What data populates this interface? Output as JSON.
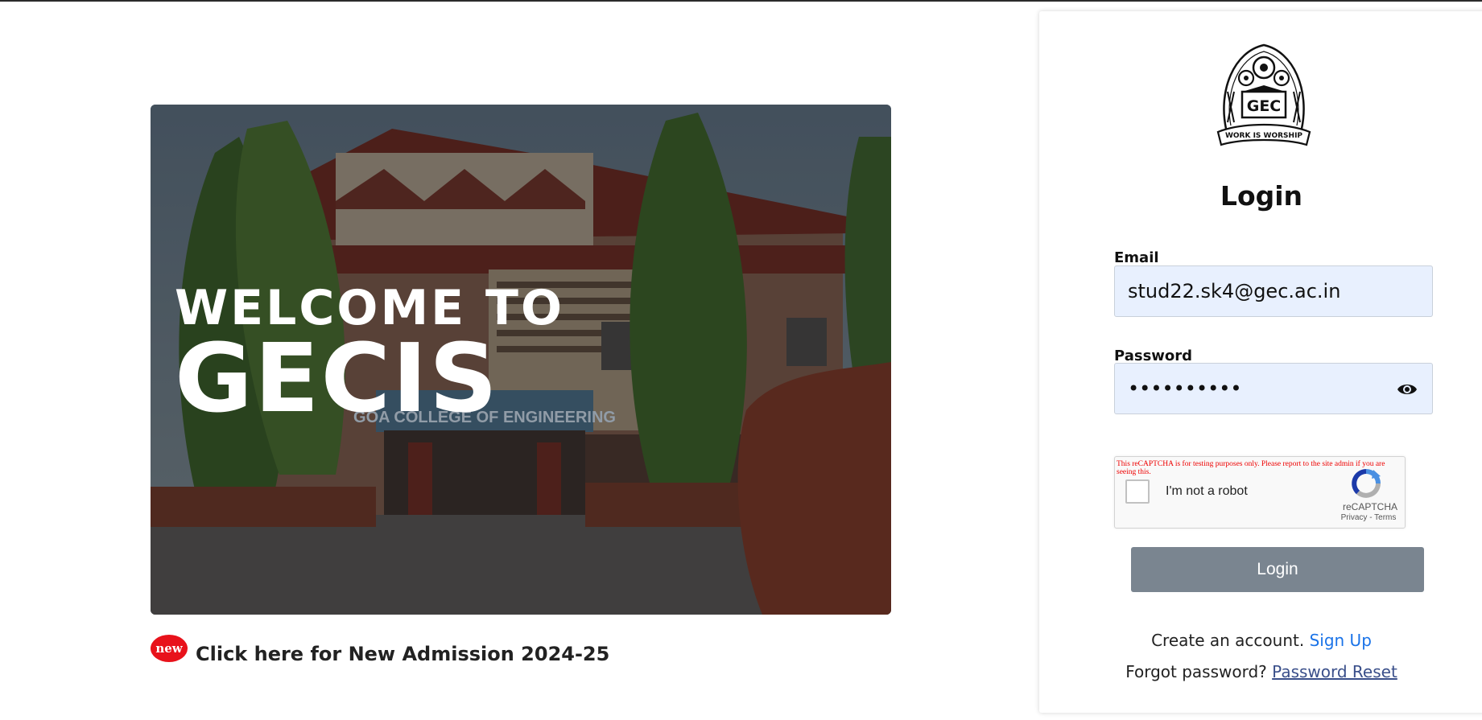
{
  "hero": {
    "welcome_line": "WELCOME TO",
    "brand_line": "GECIS",
    "building_sign": "GOA COLLEGE OF ENGINEERING"
  },
  "admission": {
    "badge": "new",
    "link_text": "Click here for New Admission 2024-25"
  },
  "logo": {
    "emblem_text": "GEC",
    "motto": "WORK IS WORSHIP"
  },
  "login": {
    "title": "Login",
    "email_label": "Email",
    "email_value": "stud22.sk4@gec.ac.in",
    "password_label": "Password",
    "password_value": "••••••••••",
    "button_label": "Login"
  },
  "recaptcha": {
    "warning": "This reCAPTCHA is for testing purposes only. Please report to the site admin if you are seeing this.",
    "checkbox_label": "I'm not a robot",
    "brand": "reCAPTCHA",
    "privacy": "Privacy",
    "separator": " - ",
    "terms": "Terms"
  },
  "footer_links": {
    "create_text": "Create an account.",
    "signup_label": "Sign Up",
    "forgot_text": "Forgot password?",
    "reset_label": "Password Reset"
  },
  "icons": {
    "password_toggle": "eye-icon",
    "recaptcha": "recaptcha-logo-icon"
  },
  "colors": {
    "accent_link": "#1a73e8",
    "login_button": "#7a8590",
    "badge": "#e8121b",
    "input_bg": "#e8f0fe"
  }
}
